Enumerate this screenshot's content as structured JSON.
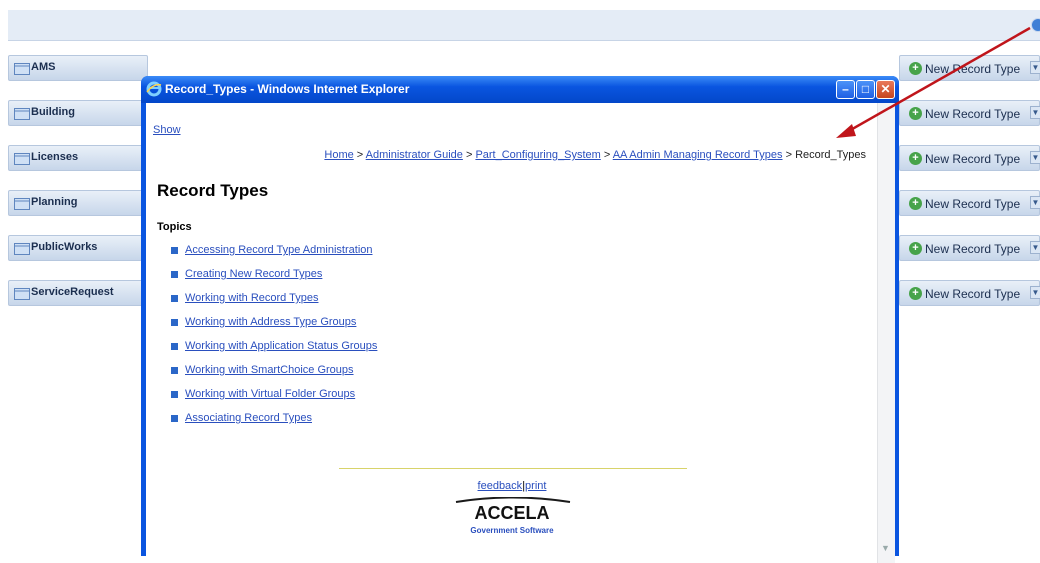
{
  "modules": [
    {
      "label": "AMS",
      "action": "New Record Type"
    },
    {
      "label": "Building",
      "action": "New Record Type"
    },
    {
      "label": "Licenses",
      "action": "New Record Type"
    },
    {
      "label": "Planning",
      "action": "New Record Type"
    },
    {
      "label": "PublicWorks",
      "action": "New Record Type"
    },
    {
      "label": "ServiceRequest",
      "action": "New Record Type"
    }
  ],
  "window": {
    "title": "Record_Types - Windows Internet Explorer",
    "controls": {
      "minimize": "–",
      "maximize": "□",
      "close": "✕"
    }
  },
  "help": {
    "show_link": "Show",
    "breadcrumb": [
      {
        "label": "Home",
        "link": true
      },
      {
        "label": "Administrator Guide",
        "link": true
      },
      {
        "label": "Part_Configuring_System",
        "link": true
      },
      {
        "label": "AA Admin Managing Record Types",
        "link": true
      },
      {
        "label": "Record_Types",
        "link": false
      }
    ],
    "separator": " > ",
    "heading": "Record Types",
    "topics_label": "Topics",
    "topics": [
      "Accessing Record Type Administration",
      "Creating New Record Types",
      "Working with Record Types",
      "Working with Address Type Groups",
      "Working with Application Status Groups",
      "Working with SmartChoice Groups",
      "Working with Virtual Folder Groups",
      "Associating Record Types"
    ],
    "footer": {
      "feedback": "feedback",
      "sep": "|",
      "print": "print"
    },
    "logo": {
      "name": "ACCELA",
      "tagline": "Government Software"
    }
  },
  "colors": {
    "annotation_arrow": "#c0151b",
    "link": "#2a4fbe",
    "titlebar": "#0a55e0"
  }
}
